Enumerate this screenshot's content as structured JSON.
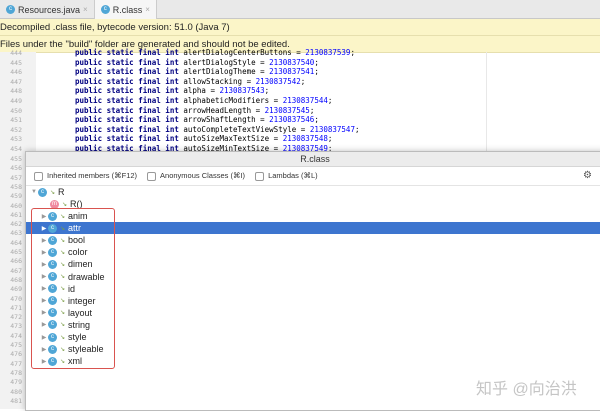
{
  "tabs": [
    {
      "label": "Resources.java",
      "active": false
    },
    {
      "label": "R.class",
      "active": true
    }
  ],
  "banners": [
    "Decompiled .class file, bytecode version: 51.0 (Java 7)",
    "Files under the \"build\" folder are generated and should not be edited."
  ],
  "code_lines": [
    {
      "ln": "444",
      "name": "alertDialogCenterButtons",
      "value": "2130837539"
    },
    {
      "ln": "445",
      "name": "alertDialogStyle",
      "value": "2130837540"
    },
    {
      "ln": "446",
      "name": "alertDialogTheme",
      "value": "2130837541"
    },
    {
      "ln": "447",
      "name": "allowStacking",
      "value": "2130837542"
    },
    {
      "ln": "448",
      "name": "alpha",
      "value": "2130837543"
    },
    {
      "ln": "449",
      "name": "alphabeticModifiers",
      "value": "2130837544"
    },
    {
      "ln": "450",
      "name": "arrowHeadLength",
      "value": "2130837545"
    },
    {
      "ln": "451",
      "name": "arrowShaftLength",
      "value": "2130837546"
    },
    {
      "ln": "452",
      "name": "autoCompleteTextViewStyle",
      "value": "2130837547"
    },
    {
      "ln": "453",
      "name": "autoSizeMaxTextSize",
      "value": "2130837548"
    },
    {
      "ln": "454",
      "name": "autoSizeMinTextSize",
      "value": "2130837549"
    }
  ],
  "code_prefix": "public static final int",
  "more_line_numbers": [
    "455",
    "456",
    "457",
    "458",
    "459",
    "460",
    "461",
    "462",
    "463",
    "464",
    "465",
    "466",
    "467",
    "468",
    "469",
    "470",
    "471",
    "472",
    "473",
    "474",
    "475",
    "476",
    "477",
    "478",
    "479",
    "480",
    "481"
  ],
  "popup": {
    "title": "R.class",
    "options": [
      "Inherited members (⌘F12)",
      "Anonymous Classes (⌘I)",
      "Lambdas (⌘L)"
    ],
    "root": "R",
    "constructor": "R()",
    "classes": [
      "anim",
      "attr",
      "bool",
      "color",
      "dimen",
      "drawable",
      "id",
      "integer",
      "layout",
      "string",
      "style",
      "styleable",
      "xml"
    ],
    "selected": "attr"
  },
  "watermark": "知乎 @向治洪"
}
